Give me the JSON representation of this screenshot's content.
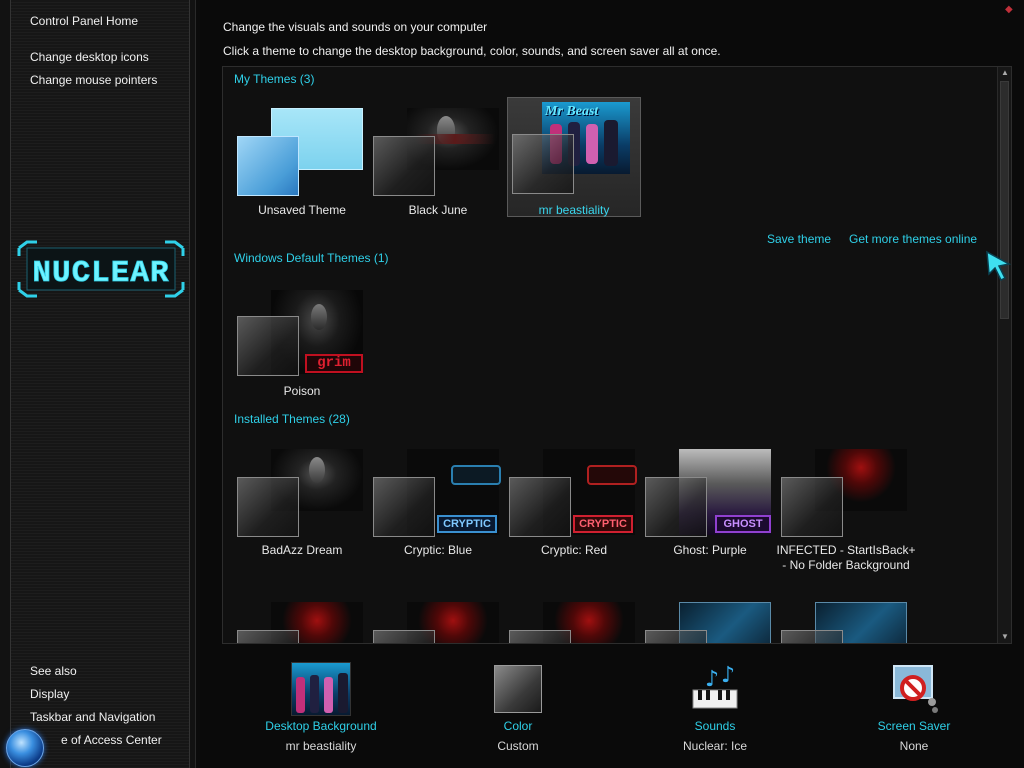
{
  "sidebar": {
    "links": [
      {
        "label": "Control Panel Home"
      },
      {
        "label": "Change desktop icons"
      },
      {
        "label": "Change mouse pointers"
      }
    ],
    "logo_text": "NUCLEAR",
    "see_also": {
      "title": "See also",
      "links": [
        {
          "label": "Display"
        },
        {
          "label": "Taskbar and Navigation"
        },
        {
          "label": "e of Access Center"
        }
      ]
    }
  },
  "header": {
    "title": "Change the visuals and sounds on your computer",
    "subtitle": "Click a theme to change the desktop background, color, sounds, and screen saver all at once."
  },
  "sections": {
    "my_themes": "My Themes (3)",
    "windows_default": "Windows Default Themes (1)",
    "installed": "Installed Themes (28)"
  },
  "my_themes": [
    {
      "name": "Unsaved Theme",
      "wall": "blue"
    },
    {
      "name": "Black June",
      "wall": "dark-alien"
    },
    {
      "name": "mr beastiality",
      "wall": "mrbeast-art",
      "selected": true
    }
  ],
  "wall_text": {
    "mrbeast": "Mr Beast",
    "grim": "grim",
    "cryptic": "CRYPTIC",
    "ghost": "GHOST"
  },
  "actions": {
    "save": "Save theme",
    "more": "Get more themes online"
  },
  "windows_default_themes": [
    {
      "name": "Poison",
      "wall": "grim"
    }
  ],
  "installed_themes": [
    {
      "name": "BadAzz Dream",
      "wall": "dark-alien"
    },
    {
      "name": "Cryptic: Blue",
      "wall": "cryptic-blue"
    },
    {
      "name": "Cryptic: Red",
      "wall": "cryptic-red"
    },
    {
      "name": "Ghost: Purple",
      "wall": "ghost"
    },
    {
      "name": "INFECTED - StartIsBack+ - No Folder Background",
      "wall": "red-orb"
    },
    {
      "name": "",
      "wall": "red-orb"
    },
    {
      "name": "",
      "wall": "red-orb"
    },
    {
      "name": "",
      "wall": "red-orb"
    },
    {
      "name": "",
      "wall": "stack"
    },
    {
      "name": "",
      "wall": "stack"
    }
  ],
  "bottom": {
    "background": {
      "title": "Desktop Background",
      "value": "mr beastiality"
    },
    "color": {
      "title": "Color",
      "value": "Custom"
    },
    "sounds": {
      "title": "Sounds",
      "value": "Nuclear: Ice"
    },
    "screensaver": {
      "title": "Screen Saver",
      "value": "None"
    }
  },
  "colors": {
    "accent": "#2fd0e8",
    "selected_text": "#39d6ee",
    "background": "#0a0a0a"
  }
}
